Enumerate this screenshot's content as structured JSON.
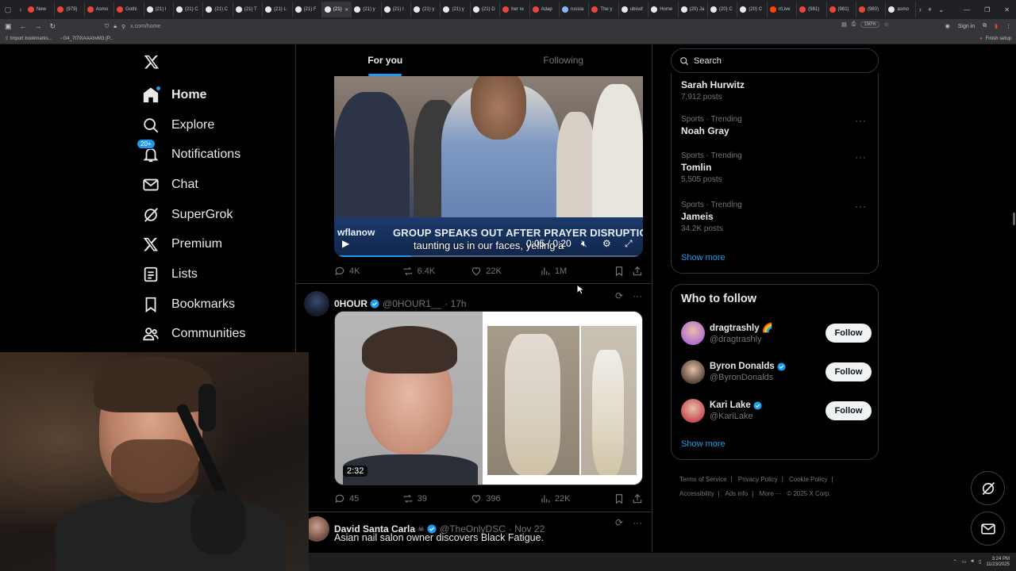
{
  "browser": {
    "tabs": [
      {
        "label": "New",
        "color": "#e8453c"
      },
      {
        "label": "(979)",
        "color": "#e8453c"
      },
      {
        "label": "Asmo",
        "color": "#e8453c"
      },
      {
        "label": "Gothi",
        "color": "#e8453c"
      },
      {
        "label": "(21) I",
        "color": "#e7e9ea"
      },
      {
        "label": "(21) C",
        "color": "#e7e9ea"
      },
      {
        "label": "(21) C",
        "color": "#e7e9ea"
      },
      {
        "label": "(21) T",
        "color": "#e7e9ea"
      },
      {
        "label": "(21) L",
        "color": "#e7e9ea"
      },
      {
        "label": "(21) F",
        "color": "#e7e9ea"
      },
      {
        "label": "(21)",
        "color": "#e7e9ea",
        "active": true
      },
      {
        "label": "(21) y",
        "color": "#e7e9ea"
      },
      {
        "label": "(21) I",
        "color": "#e7e9ea"
      },
      {
        "label": "(21) y",
        "color": "#e7e9ea"
      },
      {
        "label": "(21) y",
        "color": "#e7e9ea"
      },
      {
        "label": "(21) D",
        "color": "#e7e9ea"
      },
      {
        "label": "her re",
        "color": "#e8453c"
      },
      {
        "label": "Adap",
        "color": "#e8453c"
      },
      {
        "label": "russia",
        "color": "#8ab4f8"
      },
      {
        "label": "The y",
        "color": "#e8453c"
      },
      {
        "label": "ubisof",
        "color": "#e7e9ea"
      },
      {
        "label": "Home",
        "color": "#e7e9ea"
      },
      {
        "label": "(20) Ja",
        "color": "#e7e9ea"
      },
      {
        "label": "(20) C",
        "color": "#e7e9ea"
      },
      {
        "label": "(20) C",
        "color": "#e7e9ea"
      },
      {
        "label": "r/Live",
        "color": "#ff4500"
      },
      {
        "label": "(981)",
        "color": "#e8453c"
      },
      {
        "label": "(981)",
        "color": "#e8453c"
      },
      {
        "label": "(980)",
        "color": "#e8453c"
      },
      {
        "label": "asmo",
        "color": "#e7e9ea"
      }
    ],
    "url": "x.com/home",
    "zoom": "150%",
    "sign_in": "Sign in",
    "bookmark_1": "Import bookmarks...",
    "bookmark_2": "G4_7t7lXAAAhvM3 (P...",
    "finish_setup": "Finish setup"
  },
  "nav": {
    "home": "Home",
    "explore": "Explore",
    "notifications": "Notifications",
    "notifications_badge": "20+",
    "chat": "Chat",
    "supergrok": "SuperGrok",
    "premium": "Premium",
    "lists": "Lists",
    "bookmarks": "Bookmarks",
    "communities": "Communities"
  },
  "feed": {
    "tab_for_you": "For you",
    "tab_following": "Following",
    "post1": {
      "video_brand": "wflanow",
      "chyron": "GROUP SPEAKS OUT AFTER PRAYER DISRUPTION AT US",
      "caption": "taunting us in our faces, yelling a",
      "time": "0:05 / 0:20",
      "progress": 0.25,
      "replies": "4K",
      "reposts": "6.4K",
      "likes": "22K",
      "views": "1M"
    },
    "post2": {
      "name": "0HOUR",
      "handle": "@0HOUR1__",
      "time": "· 17h",
      "duration": "2:32",
      "replies": "45",
      "reposts": "39",
      "likes": "396",
      "views": "22K"
    },
    "post3": {
      "name": "David Santa Carla",
      "handle": "@TheOnlyDSC",
      "time": "· Nov 22",
      "text": "Asian nail salon owner discovers Black Fatigue."
    }
  },
  "sidebar_right": {
    "search_placeholder": "Search",
    "trends": [
      {
        "category": "",
        "title": "Sarah Hurwitz",
        "posts": "7,912 posts"
      },
      {
        "category": "Sports · Trending",
        "title": "Noah Gray",
        "posts": ""
      },
      {
        "category": "Sports · Trending",
        "title": "Tomlin",
        "posts": "5,505 posts"
      },
      {
        "category": "Sports · Trending",
        "title": "Jameis",
        "posts": "34.2K posts"
      }
    ],
    "trends_show_more": "Show more",
    "who_to_follow": {
      "title": "Who to follow",
      "accounts": [
        {
          "name": "dragtrashly 🌈",
          "handle": "@dragtrashly",
          "verified": false,
          "color": "#b46fd0"
        },
        {
          "name": "Byron Donalds",
          "handle": "@ByronDonalds",
          "verified": true,
          "color": "#5a4a3e"
        },
        {
          "name": "Kari Lake",
          "handle": "@KariLake",
          "verified": true,
          "color": "#c84f57"
        }
      ],
      "follow_label": "Follow",
      "show_more": "Show more"
    },
    "footer": {
      "terms": "Terms of Service",
      "privacy": "Privacy Policy",
      "cookie": "Cookie Policy",
      "accessibility": "Accessibility",
      "ads": "Ads info",
      "more": "More ···",
      "copyright": "© 2025 X Corp."
    }
  },
  "taskbar": {
    "time": "3:24 PM",
    "date": "11/23/2025"
  },
  "colors": {
    "accent": "#1d9bf0",
    "background": "#000000",
    "text_primary": "#e7e9ea",
    "text_secondary": "#71767b"
  }
}
